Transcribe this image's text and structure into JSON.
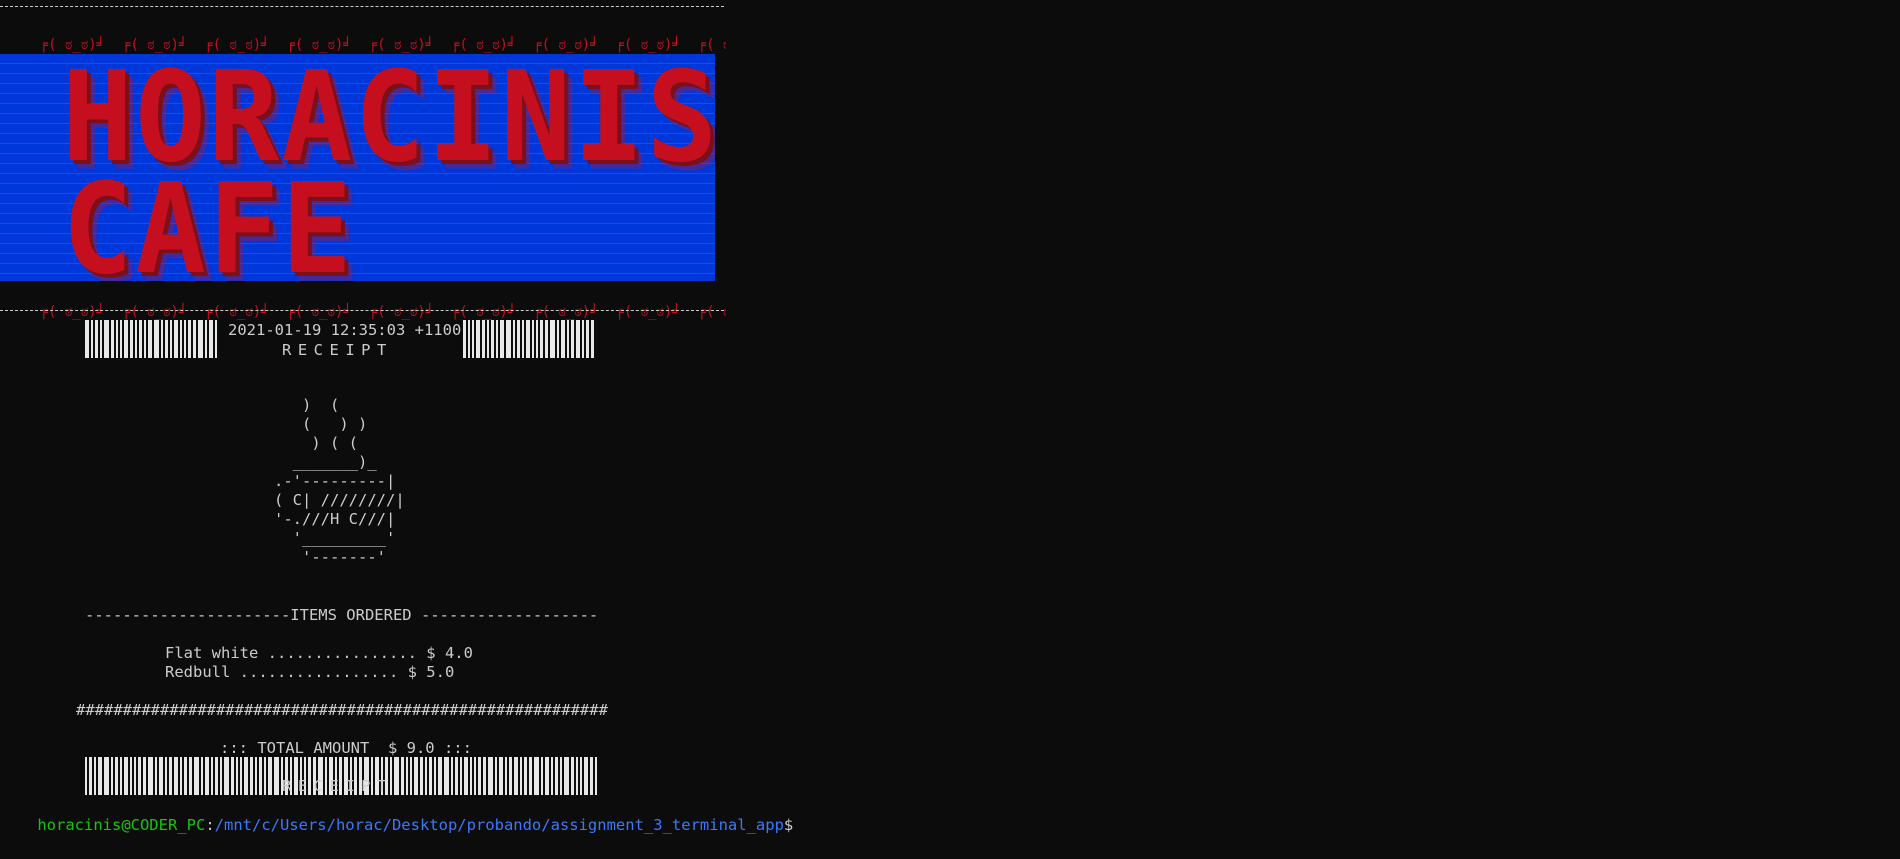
{
  "face_token": "╒( ಠ_ಠ)╛",
  "banner": {
    "line1": "HORACINIS",
    "line2": "CAFE",
    "bg_color": "#0037da",
    "text_color": "#c50f1f"
  },
  "receipt": {
    "datetime": "2021-01-19 12:35:03 +1100",
    "label": "RECEIPT"
  },
  "cup_art": "   )  (\n   (   ) )\n    ) ( (\n  _______)_\n.-'---------|\n( C| ////////|\n'-.///H C///|\n  '_________'\n   '-------'",
  "items_header": "----------------------ITEMS ORDERED -------------------",
  "items": [
    {
      "text": "Flat white ................ $ 4.0"
    },
    {
      "text": "Redbull ................. $ 5.0"
    }
  ],
  "separator": "#########################################################",
  "total": "::: TOTAL AMOUNT  $ 9.0 :::",
  "prompt": {
    "user_host": "horacinis@CODER_PC",
    "sep": ":",
    "path": "/mnt/c/Users/horac/Desktop/probando/assignment_3_terminal_app",
    "dollar": "$"
  },
  "colors": {
    "background": "#0c0c0c",
    "text": "#cccccc",
    "face_red": "#c50f1f",
    "prompt_green": "#16c60c",
    "prompt_blue": "#3b78ff"
  }
}
